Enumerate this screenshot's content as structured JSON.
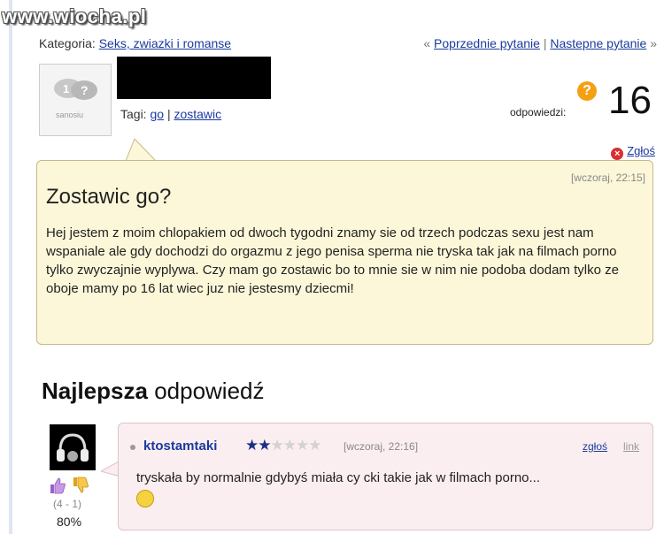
{
  "watermark": "www.wiocha.pl",
  "category": {
    "label": "Kategoria:",
    "value": "Seks, zwiazki i romanse"
  },
  "nav": {
    "prev": "Poprzednie pytanie",
    "separator": "|",
    "next": "Nastepne pytanie"
  },
  "avatar": {
    "caption": "sanosiu"
  },
  "tags": {
    "label": "Tagi:",
    "items": [
      "go",
      "zostawic"
    ],
    "separator": "|"
  },
  "answers": {
    "label": "odpowiedzi:",
    "count": "16"
  },
  "report": {
    "label": "Zgłoś"
  },
  "question": {
    "timestamp": "[wczoraj, 22:15]",
    "title": "Zostawic go?",
    "body": "Hej jestem z moim chlopakiem od dwoch tygodni znamy sie od trzech podczas sexu jest nam wspaniale ale gdy dochodzi do orgazmu z jego penisa sperma nie tryska tak jak na filmach porno tylko zwyczajnie wyplywa. Czy mam go zostawic bo to mnie sie w nim nie podoba dodam tylko ze oboje mamy po 16 lat wiec juz nie jestesmy dziecmi!"
  },
  "best_answer": {
    "heading_bold": "Najlepsza",
    "heading_rest": "odpowiedź",
    "user": "ktostamtaki",
    "rating": 1.5,
    "rating_max": 5,
    "timestamp": "[wczoraj, 22:16]",
    "report_link": "zgłoś",
    "link_label": "link",
    "text": "tryskała by normalnie gdybyś miała cy cki takie jak w filmach porno...",
    "votes": "(4 - 1)",
    "percent": "80%"
  },
  "colors": {
    "link": "#1a3a9e",
    "question_bg": "#fdf7d9",
    "answer_bg": "#fbeef0",
    "icon_orange": "#f4a012"
  }
}
